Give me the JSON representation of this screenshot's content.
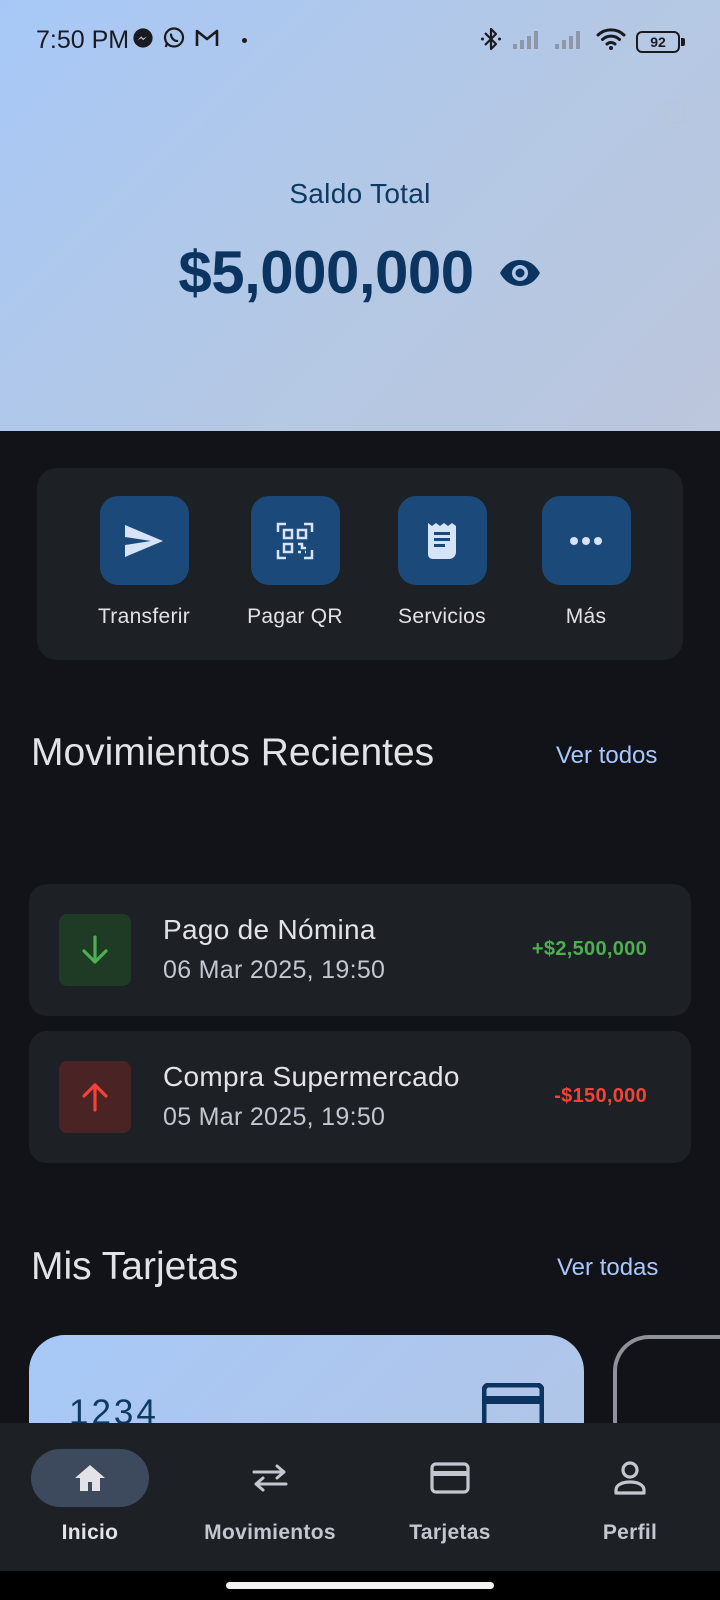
{
  "status_bar": {
    "time": "7:50 PM",
    "battery": "92",
    "icons": [
      "messenger-icon",
      "whatsapp-icon",
      "gmail-icon",
      "bluetooth-icon",
      "signal-icon",
      "signal-icon",
      "wifi-icon",
      "battery-icon"
    ]
  },
  "header": {
    "balance_label": "Saldo Total",
    "balance_amount": "$5,000,000"
  },
  "quick_actions": [
    {
      "label": "Transferir",
      "icon": "send-icon"
    },
    {
      "label": "Pagar QR",
      "icon": "qr-code-icon"
    },
    {
      "label": "Servicios",
      "icon": "receipt-icon"
    },
    {
      "label": "Más",
      "icon": "more-dots-icon"
    }
  ],
  "recent": {
    "title": "Movimientos Recientes",
    "link": "Ver todos",
    "items": [
      {
        "title": "Pago de Nómina",
        "date": "06 Mar 2025, 19:50",
        "amount": "+$2,500,000",
        "direction": "in",
        "color": "#4caf50"
      },
      {
        "title": "Compra Supermercado",
        "date": "05 Mar 2025, 19:50",
        "amount": "-$150,000",
        "direction": "out",
        "color": "#f44336"
      }
    ]
  },
  "cards": {
    "title": "Mis Tarjetas",
    "link": "Ver todas",
    "first_card_number": "1234"
  },
  "bottom_nav": [
    {
      "label": "Inicio",
      "icon": "home-icon",
      "active": true
    },
    {
      "label": "Movimientos",
      "icon": "swap-arrows-icon",
      "active": false
    },
    {
      "label": "Tarjetas",
      "icon": "credit-card-icon",
      "active": false
    },
    {
      "label": "Perfil",
      "icon": "person-icon",
      "active": false
    }
  ],
  "colors": {
    "background": "#111318",
    "surface": "#1d2025",
    "accent": "#a9c7ff",
    "tile": "#1b4a7a",
    "positive": "#4caf50",
    "negative": "#f44336"
  }
}
